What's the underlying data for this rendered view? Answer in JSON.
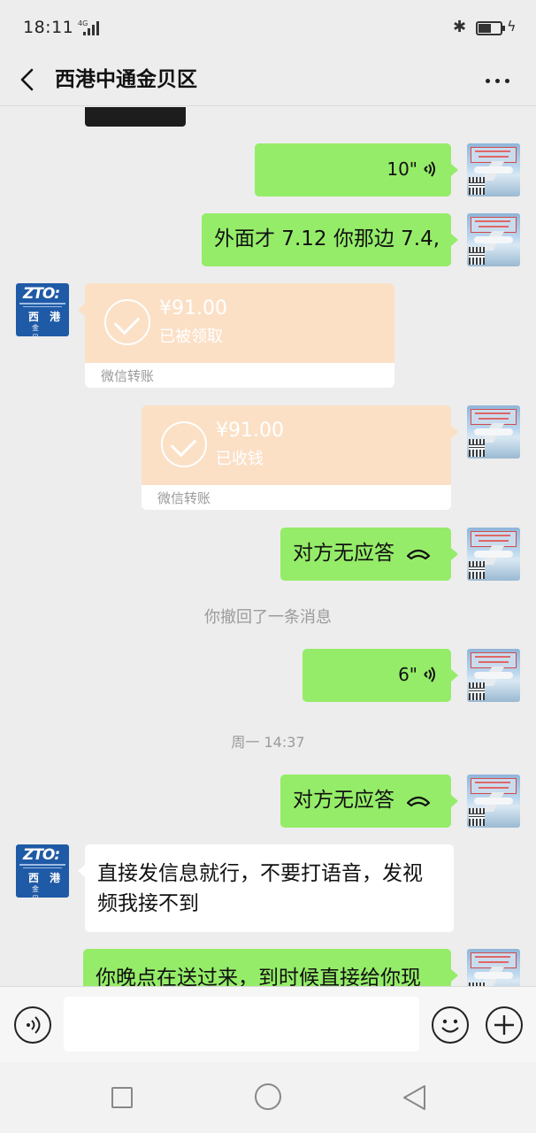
{
  "status_bar": {
    "time": "18:11",
    "network": "4G",
    "bluetooth_glyph": "✱",
    "charging_glyph": "ϟ"
  },
  "header": {
    "title": "西港中通金贝区",
    "back_icon": "chevron-left-icon",
    "more_icon": "more-dots-icon"
  },
  "avatars": {
    "self": {
      "icon": "airplane-promo-avatar"
    },
    "contact": {
      "logo": "ZTO:",
      "line1": "西 港",
      "line2": "金 贝"
    }
  },
  "messages": {
    "voice1": {
      "duration": "10\""
    },
    "text1": {
      "text": "外面才 7.12 你那边 7.4,"
    },
    "transfer_in": {
      "amount": "¥91.00",
      "status": "已被领取",
      "footer": "微信转账"
    },
    "transfer_out": {
      "amount": "¥91.00",
      "status": "已收钱",
      "footer": "微信转账"
    },
    "call1": {
      "text": "对方无应答"
    },
    "recall_notice": "你撤回了一条消息",
    "voice2": {
      "duration": "6\""
    },
    "timestamp": "周一 14:37",
    "call2": {
      "text": "对方无应答"
    },
    "text2": {
      "text": "直接发信息就行，不要打语音，发视频我接不到"
    },
    "text3": {
      "text": "你晚点在送过来，到时候直接给你现"
    }
  },
  "input_bar": {
    "voice_icon": "voice-toggle-icon",
    "emoji_icon": "emoji-icon",
    "plus_icon": "plus-icon"
  },
  "colors": {
    "my_bubble": "#95ec69",
    "their_bubble": "#ffffff",
    "transfer": "#fbe0c6",
    "background": "#ededed"
  }
}
